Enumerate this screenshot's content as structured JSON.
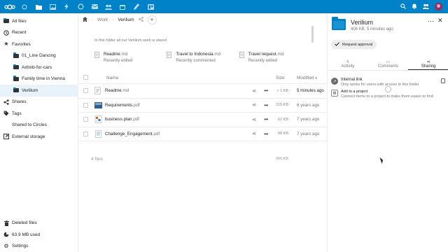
{
  "topbar": {
    "apps": [
      {
        "name": "dashboard",
        "active": false
      },
      {
        "name": "files",
        "active": true
      },
      {
        "name": "photos",
        "active": false
      },
      {
        "name": "activity",
        "active": false
      },
      {
        "name": "talk",
        "active": false
      },
      {
        "name": "mail",
        "active": false
      },
      {
        "name": "contacts",
        "active": false
      },
      {
        "name": "calendar",
        "active": false
      },
      {
        "name": "notes",
        "active": false
      },
      {
        "name": "deck",
        "active": false
      }
    ],
    "brand_color": "#0082c9"
  },
  "sidebar": {
    "items": [
      {
        "label": "All files",
        "icon": "folder-icon"
      },
      {
        "label": "Recent",
        "icon": "clock-icon"
      },
      {
        "label": "Favorites",
        "icon": "star-icon"
      },
      {
        "label": "01_Line Dancing",
        "icon": "folder-icon"
      },
      {
        "label": "Airbnb-for-cars",
        "icon": "folder-icon"
      },
      {
        "label": "Family time in Vienna",
        "icon": "folder-icon"
      },
      {
        "label": "Verilium",
        "icon": "folder-icon"
      },
      {
        "label": "Shares",
        "icon": "share-icon"
      },
      {
        "label": "Tags",
        "icon": "tag-icon"
      },
      {
        "label": "Shared to Circles",
        "icon": ""
      },
      {
        "label": "External storage",
        "icon": "external-storage-icon"
      }
    ],
    "bottom": {
      "deleted": "Deleted files",
      "quota": "63.9 MB used",
      "settings": "Settings"
    }
  },
  "breadcrumb": {
    "items": [
      "Work",
      "Verilium"
    ]
  },
  "intro": "In this folder all our Verilium work is stored",
  "recents": [
    {
      "name": "Readme",
      "ext": ".md",
      "sub": "Recently edited"
    },
    {
      "name": "Travel to Indonesia",
      "ext": ".md",
      "sub": "Recently commented"
    },
    {
      "name": "Travel request",
      "ext": ".md",
      "sub": "Recently edited"
    }
  ],
  "table": {
    "headers": {
      "name": "Name",
      "size": "Size",
      "modified": "Modified"
    },
    "rows": [
      {
        "name": "Readme",
        "ext": ".md",
        "size": "< 1 KB",
        "modified": "5 minutes ago",
        "icon": "text-file-icon"
      },
      {
        "name": "Requirements",
        "ext": ".pdf",
        "size": "215 KB",
        "modified": "6 years ago",
        "icon": "pdf-thumbnail-icon"
      },
      {
        "name": "business plan",
        "ext": ".pdf",
        "size": "62 KB",
        "modified": "7 years ago",
        "icon": "pdf-thumbnail-icon"
      },
      {
        "name": "Challenge_Engagement",
        "ext": ".pdf",
        "size": "98 KB",
        "modified": "7 years ago",
        "icon": "pdf-thumbnail-icon"
      }
    ],
    "summary": {
      "count": "4 files",
      "total": "406 KB"
    }
  },
  "panel": {
    "title": "Verilium",
    "subtitle": "406 KB, 5 minutes ago",
    "request_btn": "Request approval",
    "tabs": [
      {
        "label": "Activity",
        "icon": "activity-icon",
        "active": false
      },
      {
        "label": "Comments",
        "icon": "comment-icon",
        "active": false
      },
      {
        "label": "Sharing",
        "icon": "share-icon",
        "active": true
      }
    ],
    "internal_link": {
      "title": "Internal link",
      "sub": "Only works for users with access to this folder"
    },
    "project": {
      "title": "Add to a project",
      "sub": "Connect items to a project to make them easier to find"
    }
  }
}
